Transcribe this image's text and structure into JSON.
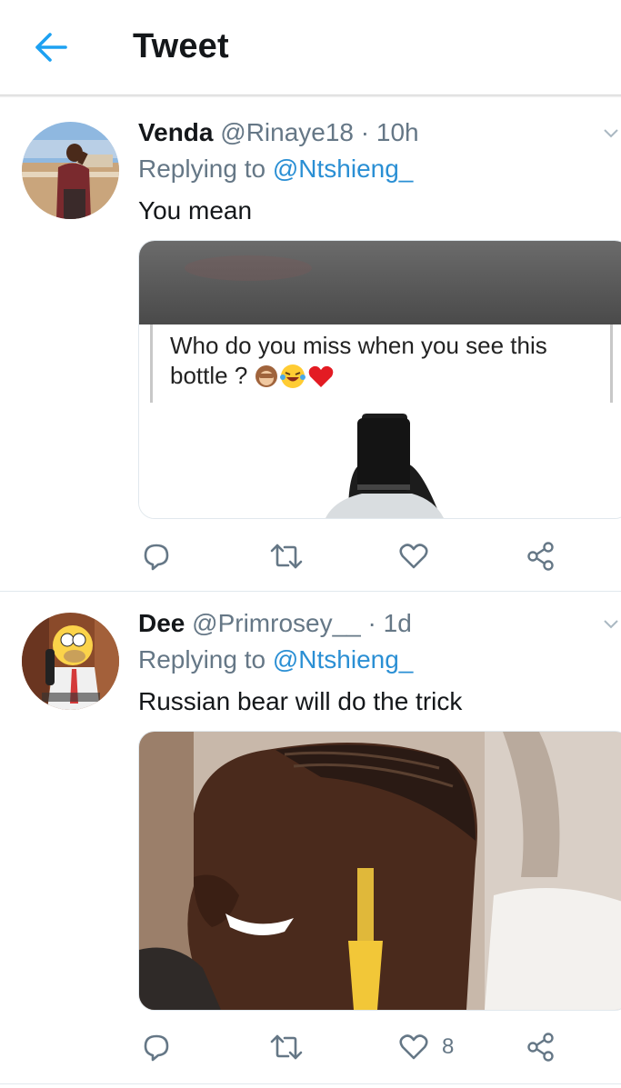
{
  "header": {
    "title": "Tweet",
    "back_icon": "arrow-left-icon",
    "accent": "#1da1f2"
  },
  "tweets": [
    {
      "name": "Venda",
      "handle": "@Rinaye18",
      "separator": "·",
      "time": "10h",
      "replying_prefix": "Replying to",
      "replying_to": "@Ntshieng_",
      "text": "You mean",
      "media": {
        "caption_line1": "Who do you miss when you see this",
        "caption_line2": "bottle ?"
      },
      "actions": {
        "reply": "",
        "retweet": "",
        "like": "",
        "share": ""
      }
    },
    {
      "name": "Dee",
      "handle": "@Primrosey__",
      "separator": "·",
      "time": "1d",
      "replying_prefix": "Replying to",
      "replying_to": "@Ntshieng_",
      "text": "Russian bear will do the trick",
      "actions": {
        "reply": "",
        "retweet": "",
        "like": "8",
        "share": ""
      }
    }
  ]
}
